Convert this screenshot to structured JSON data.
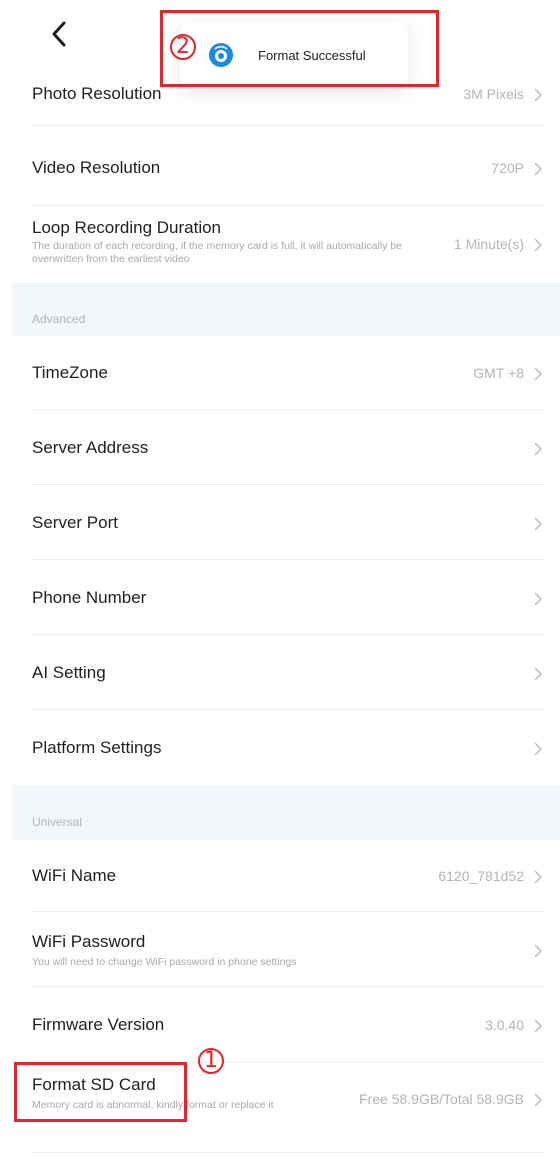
{
  "toast": {
    "text": "Format Successful"
  },
  "annotations": {
    "step1": "1",
    "step2": "2",
    "color": "#e3262c"
  },
  "basic": [
    {
      "title": "Photo Resolution",
      "value": "3M Pixels"
    },
    {
      "title": "Video Resolution",
      "value": "720P"
    },
    {
      "title": "Loop Recording Duration",
      "subtitle": "The duration of each recording, if the memory card is full, it will automatically be overwritten from the earliest video",
      "value": "1 Minute(s)"
    }
  ],
  "advanced": {
    "label": "Advanced",
    "items": [
      {
        "title": "TimeZone",
        "value": "GMT +8"
      },
      {
        "title": "Server Address",
        "value": ""
      },
      {
        "title": "Server Port",
        "value": ""
      },
      {
        "title": "Phone Number",
        "value": ""
      },
      {
        "title": "AI Setting",
        "value": ""
      },
      {
        "title": "Platform Settings",
        "value": ""
      }
    ]
  },
  "universal": {
    "label": "Universal",
    "items": [
      {
        "title": "WiFi Name",
        "value": "6120_781d52"
      },
      {
        "title": "WiFi Password",
        "subtitle": "You will need to change WiFi password in phone settings",
        "value": ""
      },
      {
        "title": "Firmware Version",
        "value": "3.0.40"
      },
      {
        "title": "Format SD Card",
        "subtitle": "Memory card is abnormal, kindly format or replace it",
        "value": "Free 58.9GB/Total 58.9GB"
      }
    ]
  },
  "colors": {
    "background": "#ffffff",
    "section_bg": "#f3f6fb",
    "value_text": "#b4b4b4",
    "toast_icon": "#1e88e5"
  }
}
